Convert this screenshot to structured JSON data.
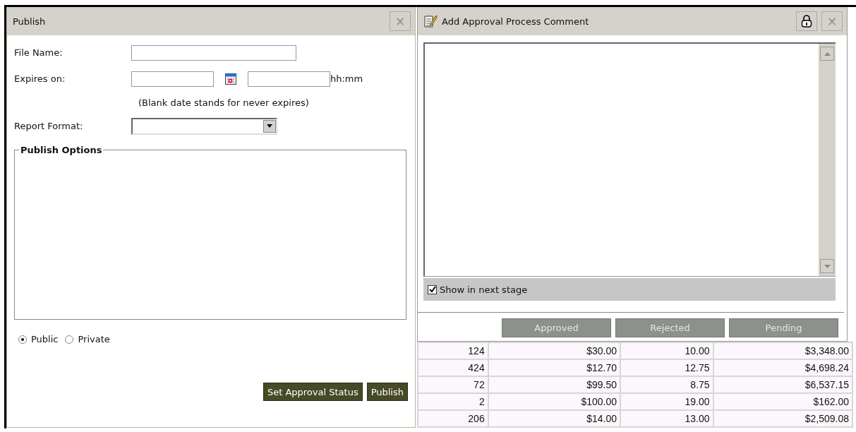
{
  "publish_panel": {
    "title": "Publish",
    "close": "×",
    "file_name": {
      "label": "File Name:"
    },
    "expires_on": {
      "label": "Expires on:",
      "time_unit": "hh:mm",
      "hint": "(Blank date stands for never expires)"
    },
    "report_format": {
      "label": "Report Format:"
    },
    "options_group": {
      "title": "Publish Options"
    },
    "visibility": [
      {
        "label": "Public",
        "selected": true
      },
      {
        "label": "Private",
        "selected": false
      }
    ],
    "buttons": [
      "Set Approval Status",
      "Publish"
    ]
  },
  "comment_dialog": {
    "title": "Add Approval Process Comment",
    "close": "×",
    "show_in_next_stage": {
      "label": "Show in next stage",
      "checked": true
    },
    "buttons": [
      {
        "label": "Approved",
        "disabled": true
      },
      {
        "label": "Rejected",
        "disabled": true
      },
      {
        "label": "Pending",
        "disabled": true
      }
    ]
  },
  "table": {
    "rows": [
      [
        "124",
        "$30.00",
        "10.00",
        "$3,348.00"
      ],
      [
        "424",
        "$12.70",
        "12.75",
        "$4,698.24"
      ],
      [
        "72",
        "$99.50",
        "8.75",
        "$6,537.15"
      ],
      [
        "2",
        "$100.00",
        "19.00",
        "$162.00"
      ],
      [
        "206",
        "$14.00",
        "13.00",
        "$2,509.08"
      ]
    ]
  }
}
